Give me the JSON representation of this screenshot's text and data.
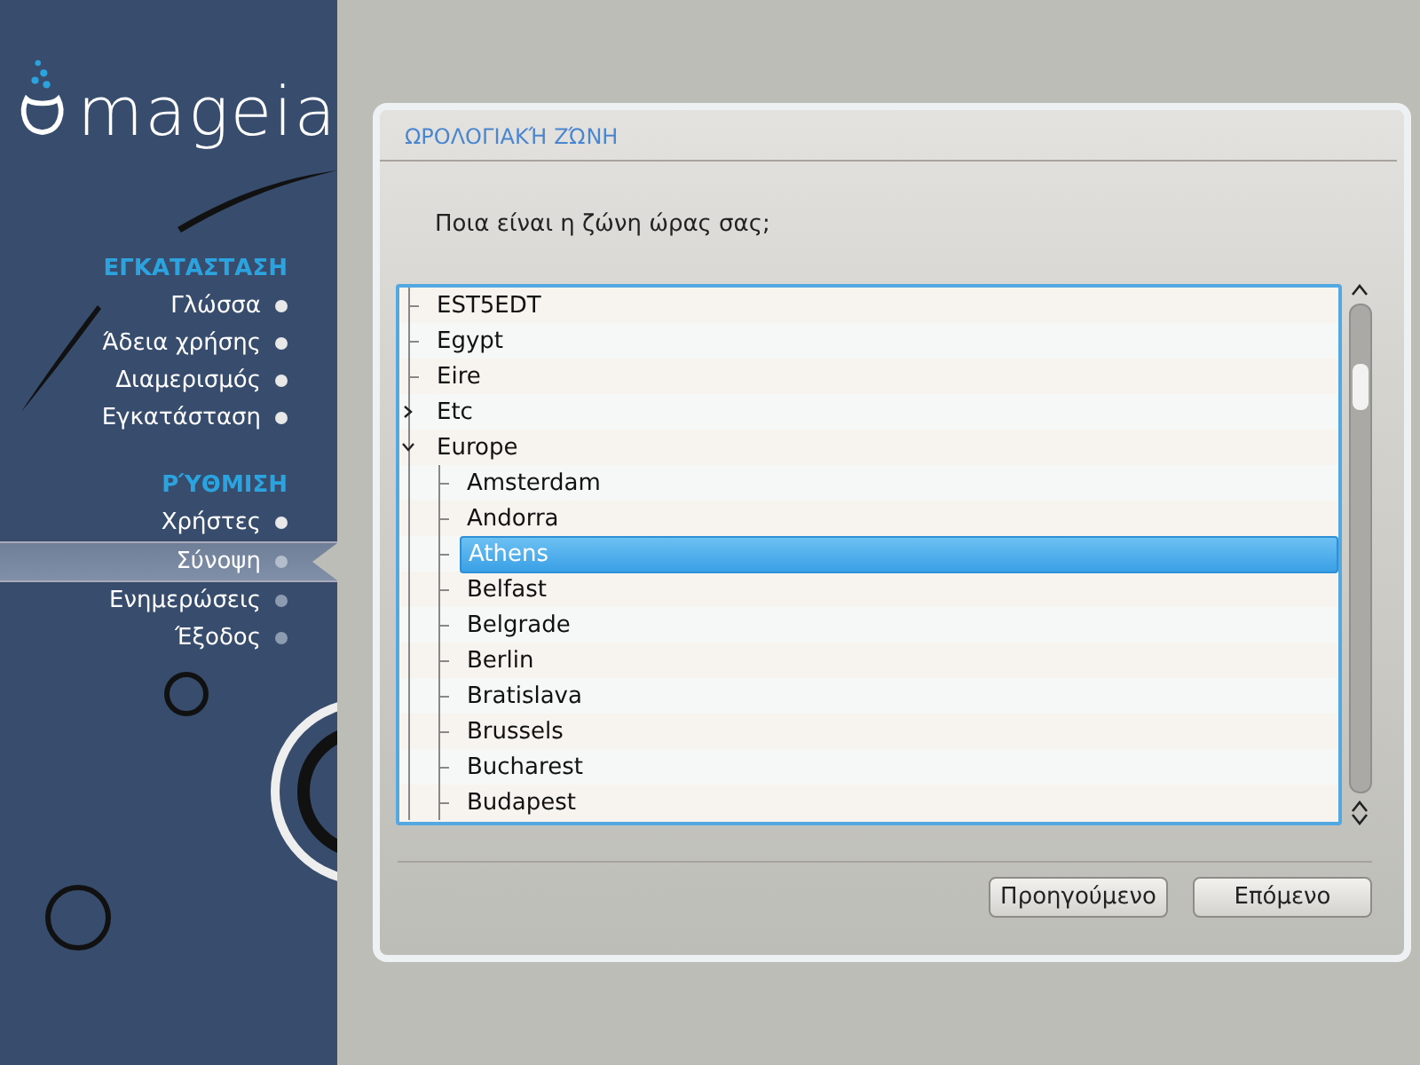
{
  "sidebar": {
    "logo": "mageia",
    "sections": [
      {
        "heading": "ΕΓΚΑΤΑΣΤΑΣΗ",
        "items": [
          {
            "label": "Γλώσσα",
            "done": true,
            "selected": false
          },
          {
            "label": "Άδεια χρήσης",
            "done": true,
            "selected": false
          },
          {
            "label": "Διαμερισμός",
            "done": true,
            "selected": false
          },
          {
            "label": "Εγκατάσταση",
            "done": true,
            "selected": false
          }
        ]
      },
      {
        "heading": "ΡΎΘΜΙΣΗ",
        "items": [
          {
            "label": "Χρήστες",
            "done": true,
            "selected": false
          },
          {
            "label": "Σύνοψη",
            "done": false,
            "selected": true
          },
          {
            "label": "Ενημερώσεις",
            "done": false,
            "selected": false
          },
          {
            "label": "Έξοδος",
            "done": false,
            "selected": false
          }
        ]
      }
    ]
  },
  "panel": {
    "title": "ΩΡΟΛΟΓΙΑΚΉ ΖΏΝΗ",
    "question": "Ποια είναι η ζώνη ώρας σας;",
    "tree": [
      {
        "label": "EST5EDT",
        "selected": false
      },
      {
        "label": "Egypt",
        "selected": false
      },
      {
        "label": "Eire",
        "selected": false
      },
      {
        "label": "Etc",
        "selected": false,
        "expanded": false
      },
      {
        "label": "Europe",
        "selected": false,
        "expanded": true,
        "children": [
          {
            "label": "Amsterdam",
            "selected": false
          },
          {
            "label": "Andorra",
            "selected": false
          },
          {
            "label": "Athens",
            "selected": true
          },
          {
            "label": "Belfast",
            "selected": false
          },
          {
            "label": "Belgrade",
            "selected": false
          },
          {
            "label": "Berlin",
            "selected": false
          },
          {
            "label": "Bratislava",
            "selected": false
          },
          {
            "label": "Brussels",
            "selected": false
          },
          {
            "label": "Bucharest",
            "selected": false
          },
          {
            "label": "Budapest",
            "selected": false
          }
        ]
      }
    ],
    "buttons": [
      "Προηγούμενο",
      "Επόμενο"
    ]
  }
}
